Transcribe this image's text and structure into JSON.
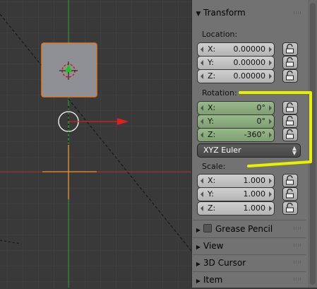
{
  "panel": {
    "transform_title": "Transform",
    "location_label": "Location:",
    "rotation_label": "Rotation:",
    "scale_label": "Scale:",
    "location": [
      {
        "axis": "X:",
        "value": "0.00000"
      },
      {
        "axis": "Y:",
        "value": "0.00000"
      },
      {
        "axis": "Z:",
        "value": "0.00000"
      }
    ],
    "rotation": [
      {
        "axis": "X:",
        "value": "0°"
      },
      {
        "axis": "Y:",
        "value": "0°"
      },
      {
        "axis": "Z:",
        "value": "-360°"
      }
    ],
    "scale": [
      {
        "axis": "X:",
        "value": "1.000"
      },
      {
        "axis": "Y:",
        "value": "1.000"
      },
      {
        "axis": "Z:",
        "value": "1.000"
      }
    ],
    "rotation_mode": "XYZ Euler",
    "sections": [
      "Grease Pencil",
      "View",
      "3D Cursor",
      "Item"
    ]
  },
  "colors": {
    "rotation_field": "#8aab7e",
    "annotation": "#e8f000",
    "x_axis": "#c83232",
    "y_axis": "#2aa02a",
    "selection": "#f08c28"
  }
}
